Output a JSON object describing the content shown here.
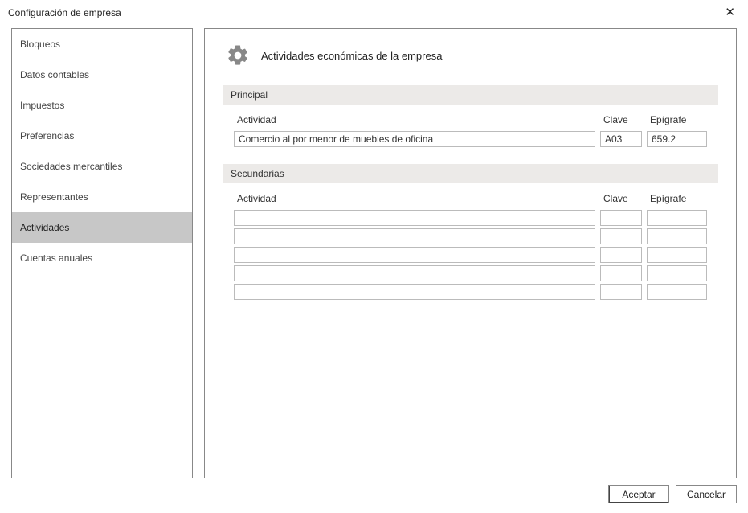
{
  "window": {
    "title": "Configuración de empresa"
  },
  "sidebar": {
    "items": [
      "Bloqueos",
      "Datos contables",
      "Impuestos",
      "Preferencias",
      "Sociedades mercantiles",
      "Representantes",
      "Actividades",
      "Cuentas anuales"
    ],
    "selected_index": 6
  },
  "content": {
    "title": "Actividades económicas de la empresa",
    "principal": {
      "header": "Principal",
      "labels": {
        "actividad": "Actividad",
        "clave": "Clave",
        "epigrafe": "Epígrafe"
      },
      "row": {
        "actividad": "Comercio al por menor de muebles de oficina",
        "clave": "A03",
        "epigrafe": "659.2"
      }
    },
    "secundarias": {
      "header": "Secundarias",
      "labels": {
        "actividad": "Actividad",
        "clave": "Clave",
        "epigrafe": "Epígrafe"
      },
      "rows": [
        {
          "actividad": "",
          "clave": "",
          "epigrafe": ""
        },
        {
          "actividad": "",
          "clave": "",
          "epigrafe": ""
        },
        {
          "actividad": "",
          "clave": "",
          "epigrafe": ""
        },
        {
          "actividad": "",
          "clave": "",
          "epigrafe": ""
        },
        {
          "actividad": "",
          "clave": "",
          "epigrafe": ""
        }
      ]
    }
  },
  "footer": {
    "accept": "Aceptar",
    "cancel": "Cancelar"
  }
}
